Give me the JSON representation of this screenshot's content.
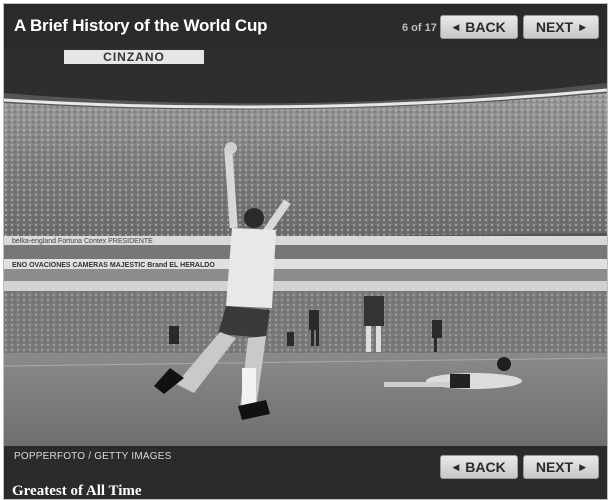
{
  "header": {
    "title": "A Brief History of the World Cup",
    "counter": "6 of 17",
    "back_label": "BACK",
    "next_label": "NEXT"
  },
  "photo": {
    "banner_text": "CINZANO",
    "ad_row_1": "belka-england   Fortuna   Contex   PRESIDENTE",
    "ad_row_2": "ENO  OVACIONES  CAMERAS  MAJESTIC  Brand  EL HERALDO",
    "credit": "POPPERFOTO / GETTY IMAGES"
  },
  "footer": {
    "back_label": "BACK",
    "next_label": "NEXT",
    "caption": "Greatest of All Time"
  },
  "colors": {
    "frame_bg": "#2b2b2b",
    "button_bg": "#d9d9d9",
    "title_text": "#ffffff"
  }
}
